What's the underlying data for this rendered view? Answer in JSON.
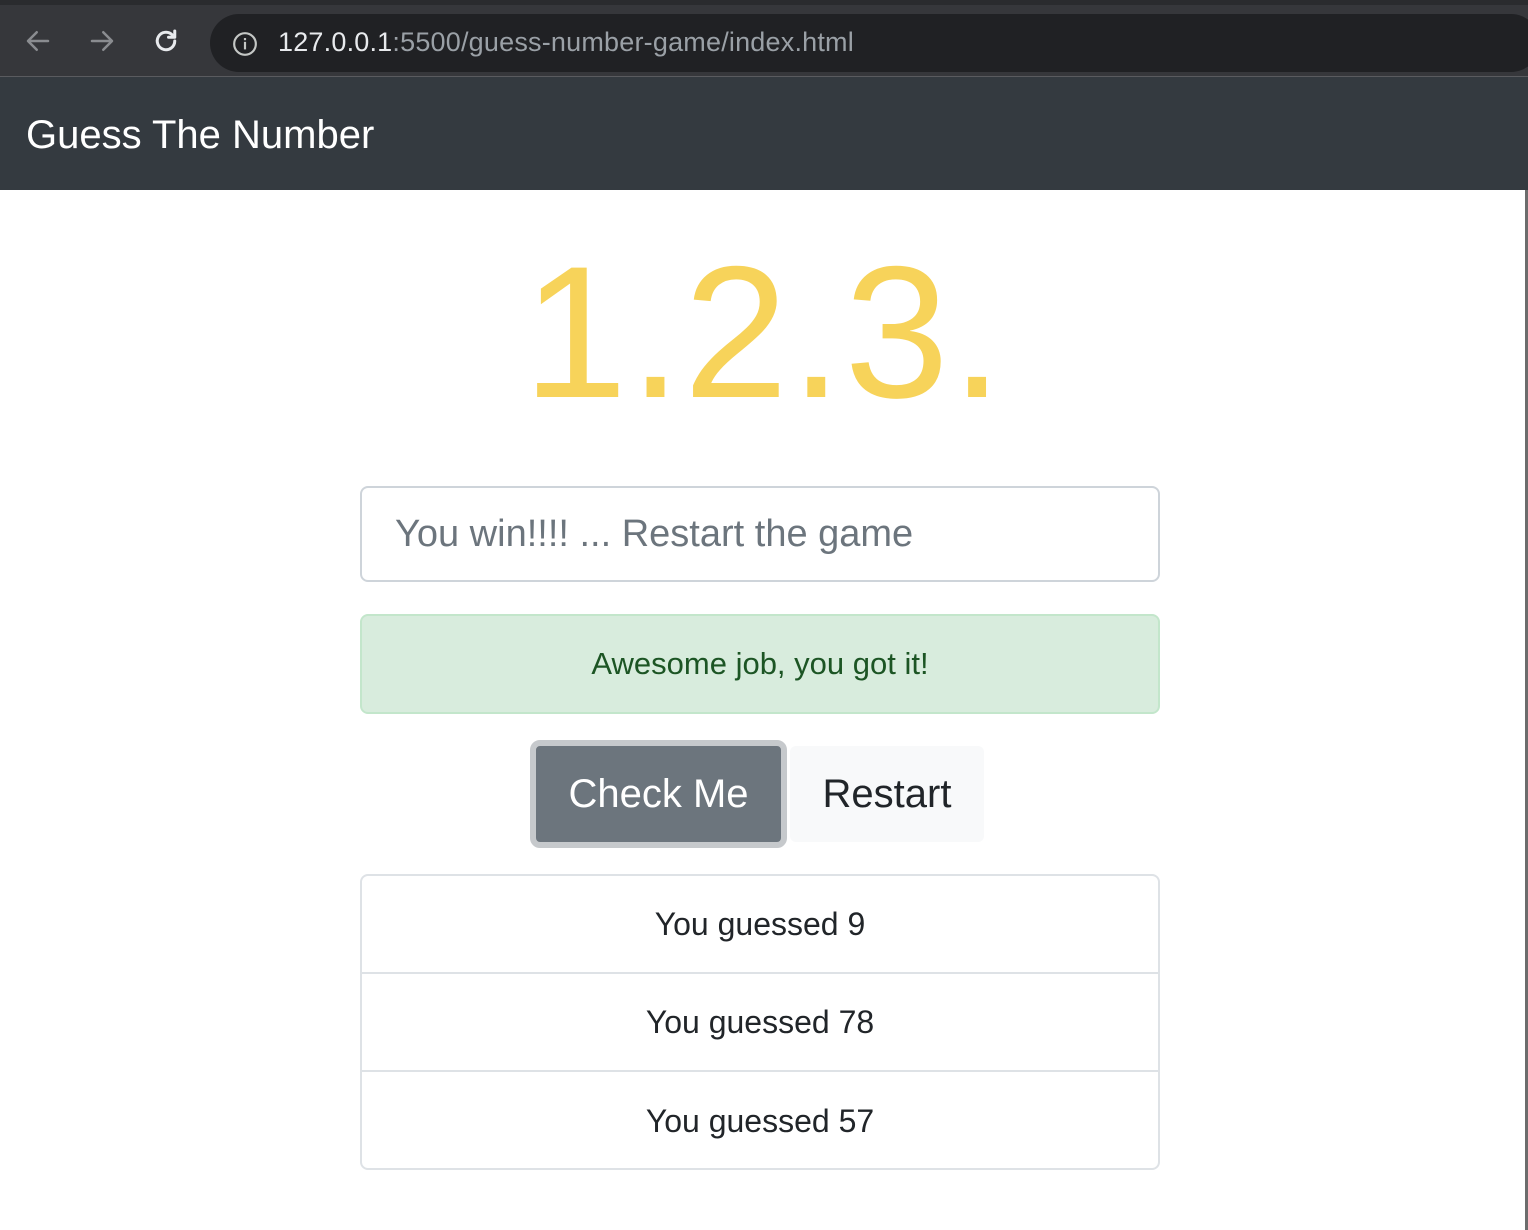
{
  "browser": {
    "back_icon": "arrow-left-icon",
    "forward_icon": "arrow-right-icon",
    "reload_icon": "reload-icon",
    "info_icon": "info-circle-icon",
    "url_host": "127.0.0.1",
    "url_rest": ":5500/guess-number-game/index.html"
  },
  "navbar": {
    "brand": "Guess The Number"
  },
  "main": {
    "big_number": "1.2.3.",
    "input_value": "",
    "input_placeholder": "You win!!!! ... Restart the game",
    "alert_text": "Awesome job, you got it!",
    "check_button": "Check Me",
    "restart_button": "Restart",
    "guesses": [
      "You guessed 9",
      "You guessed 78",
      "You guessed 57"
    ]
  },
  "colors": {
    "navbar_bg": "#343a40",
    "number_color": "#f7d35a",
    "alert_bg": "#d8ecdd",
    "alert_text": "#1c5524",
    "check_button_bg": "#6c757d",
    "restart_button_bg": "#f8f9fa"
  }
}
